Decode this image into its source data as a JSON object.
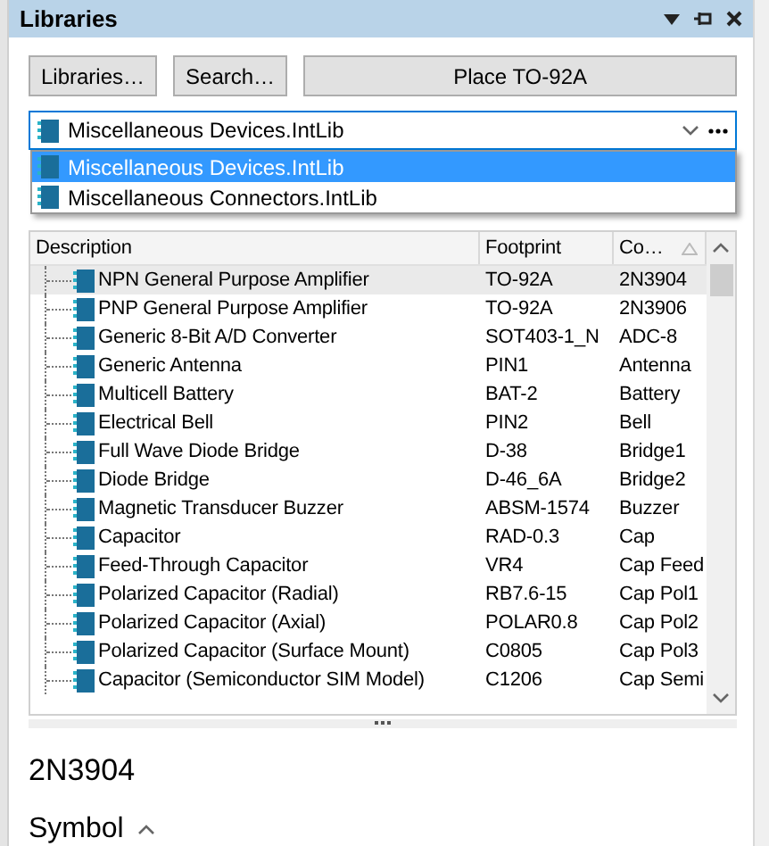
{
  "panel": {
    "title": "Libraries",
    "buttons": [
      "Libraries…",
      "Search…",
      "Place TO-92A"
    ],
    "library_select": {
      "value": "Miscellaneous Devices.IntLib",
      "options": [
        {
          "label": "Miscellaneous Devices.IntLib",
          "selected": true
        },
        {
          "label": "Miscellaneous Connectors.IntLib",
          "selected": false
        }
      ]
    },
    "table": {
      "columns": [
        {
          "label": "Description",
          "sorted": false
        },
        {
          "label": "Footprint",
          "sorted": false
        },
        {
          "label": "Co…",
          "sorted": true
        }
      ],
      "rows": [
        {
          "description": "NPN General Purpose Amplifier",
          "footprint": "TO-92A",
          "comment": "2N3904",
          "selected": true
        },
        {
          "description": "PNP General Purpose Amplifier",
          "footprint": "TO-92A",
          "comment": "2N3906",
          "selected": false
        },
        {
          "description": "Generic 8-Bit A/D Converter",
          "footprint": "SOT403-1_N",
          "comment": "ADC-8",
          "selected": false
        },
        {
          "description": "Generic Antenna",
          "footprint": "PIN1",
          "comment": "Antenna",
          "selected": false
        },
        {
          "description": "Multicell Battery",
          "footprint": "BAT-2",
          "comment": "Battery",
          "selected": false
        },
        {
          "description": "Electrical Bell",
          "footprint": "PIN2",
          "comment": "Bell",
          "selected": false
        },
        {
          "description": "Full Wave Diode Bridge",
          "footprint": "D-38",
          "comment": "Bridge1",
          "selected": false
        },
        {
          "description": "Diode Bridge",
          "footprint": "D-46_6A",
          "comment": "Bridge2",
          "selected": false
        },
        {
          "description": "Magnetic Transducer Buzzer",
          "footprint": "ABSM-1574",
          "comment": "Buzzer",
          "selected": false
        },
        {
          "description": "Capacitor",
          "footprint": "RAD-0.3",
          "comment": "Cap",
          "selected": false
        },
        {
          "description": "Feed-Through Capacitor",
          "footprint": "VR4",
          "comment": "Cap Feed",
          "selected": false
        },
        {
          "description": "Polarized Capacitor (Radial)",
          "footprint": "RB7.6-15",
          "comment": "Cap Pol1",
          "selected": false
        },
        {
          "description": "Polarized Capacitor (Axial)",
          "footprint": "POLAR0.8",
          "comment": "Cap Pol2",
          "selected": false
        },
        {
          "description": "Polarized Capacitor (Surface Mount)",
          "footprint": "C0805",
          "comment": "Cap Pol3",
          "selected": false
        },
        {
          "description": "Capacitor (Semiconductor SIM Model)",
          "footprint": "C1206",
          "comment": "Cap Semi",
          "selected": false
        }
      ]
    },
    "detail": {
      "name": "2N3904",
      "section": "Symbol",
      "section_expanded": true
    }
  }
}
